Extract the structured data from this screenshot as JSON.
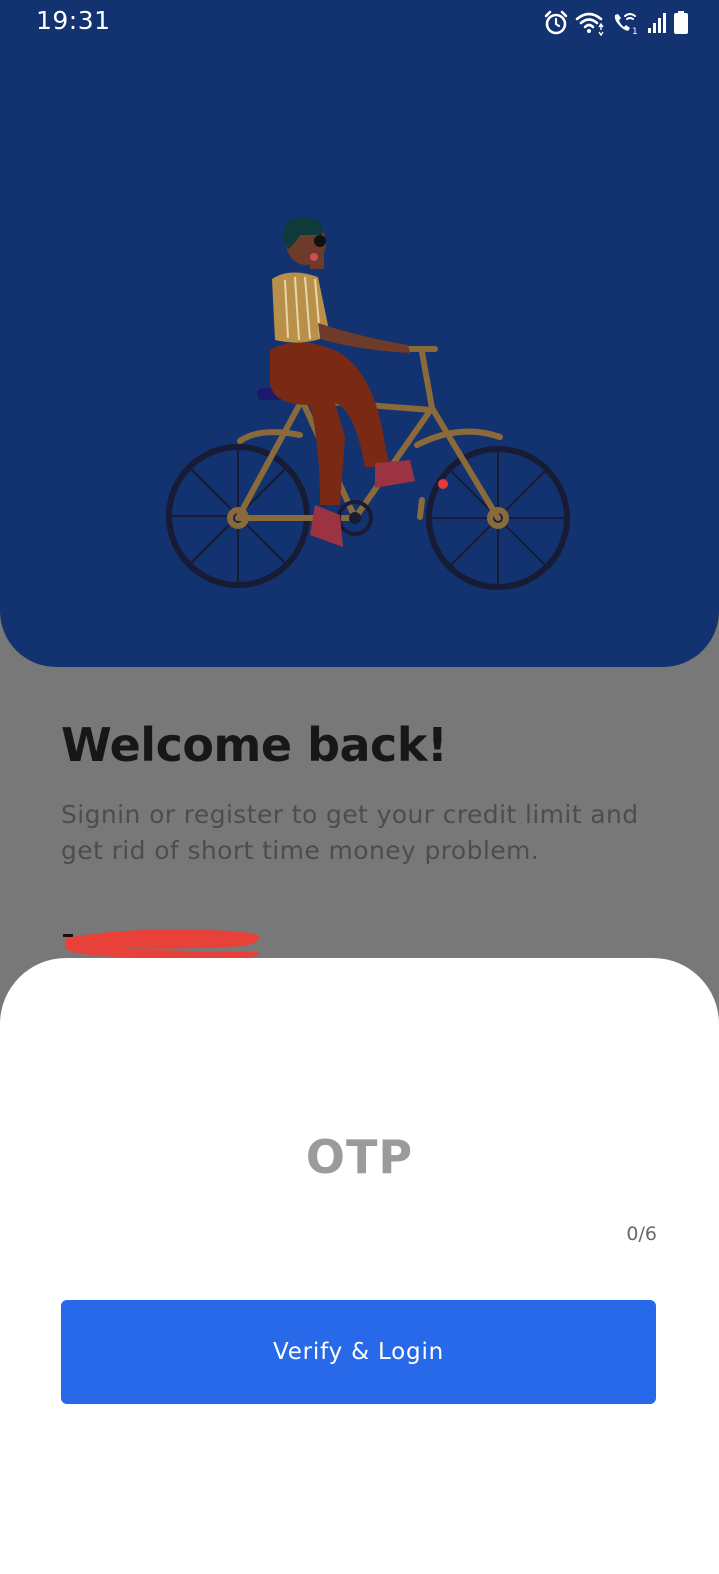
{
  "status_bar": {
    "time": "19:31",
    "icons": [
      "alarm-icon",
      "wifi-icon",
      "wifi-calling-icon",
      "signal-icon",
      "battery-icon"
    ]
  },
  "hero": {
    "illustration": "woman-riding-bicycle-illustration",
    "background_color": "#133270"
  },
  "welcome": {
    "title": "Welcome back!",
    "subtitle": "Signin or register to get your credit limit and get rid of short time money problem."
  },
  "otp_sheet": {
    "title": "OTP",
    "counter": "0/6",
    "verify_button_label": "Verify & Login",
    "accent_color": "#2869ea"
  }
}
